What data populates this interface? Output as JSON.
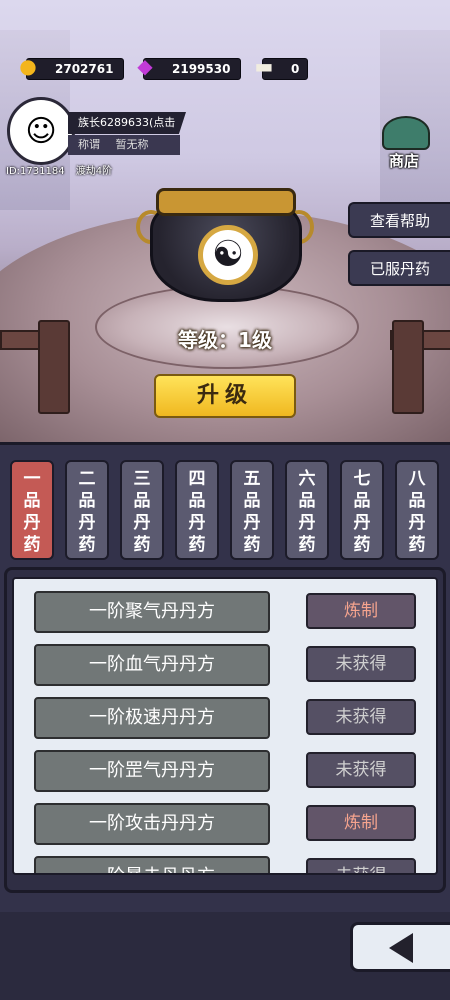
{
  "resources": {
    "gold": {
      "icon": "gold-coins-icon",
      "value": "2702761"
    },
    "gems": {
      "icon": "purple-crystal-icon",
      "value": "2199530"
    },
    "scroll": {
      "icon": "scroll-icon",
      "value": "0"
    }
  },
  "player": {
    "avatar_icon": "player-avatar-icon",
    "name": "族长6289633(点击",
    "title_label": "称谓",
    "title_value": "暂无称",
    "id": "ID:1731184",
    "stage": "渡劫4阶"
  },
  "shop": {
    "label": "商店",
    "icon": "shop-pagoda-icon"
  },
  "side_buttons": {
    "help": "查看帮助",
    "consumed": "已服丹药"
  },
  "cauldron": {
    "icon": "alchemy-cauldron-icon",
    "yin_yang": "☯"
  },
  "level_label": "等级：1级",
  "upgrade_label": "升级",
  "tabs": [
    {
      "label": [
        "一",
        "品",
        "丹",
        "药"
      ]
    },
    {
      "label": [
        "二",
        "品",
        "丹",
        "药"
      ]
    },
    {
      "label": [
        "三",
        "品",
        "丹",
        "药"
      ]
    },
    {
      "label": [
        "四",
        "品",
        "丹",
        "药"
      ]
    },
    {
      "label": [
        "五",
        "品",
        "丹",
        "药"
      ]
    },
    {
      "label": [
        "六",
        "品",
        "丹",
        "药"
      ]
    },
    {
      "label": [
        "七",
        "品",
        "丹",
        "药"
      ]
    },
    {
      "label": [
        "八",
        "品",
        "丹",
        "药"
      ]
    }
  ],
  "recipes": [
    {
      "name": "一阶聚气丹丹方",
      "action": "炼制"
    },
    {
      "name": "一阶血气丹丹方",
      "action": "未获得"
    },
    {
      "name": "一阶极速丹丹方",
      "action": "未获得"
    },
    {
      "name": "一阶罡气丹丹方",
      "action": "未获得"
    },
    {
      "name": "一阶攻击丹丹方",
      "action": "炼制"
    },
    {
      "name": "一阶暴击丹丹方",
      "action": "未获得"
    }
  ],
  "colors": {
    "active_tab": "#c45a55",
    "upgrade": "#f5c52a",
    "craft_text": "#f6a48e"
  },
  "back_icon": "back-arrow-icon"
}
